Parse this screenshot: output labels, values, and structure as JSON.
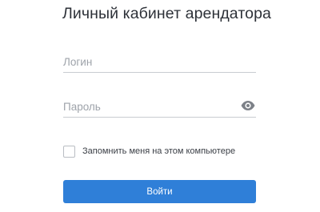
{
  "page": {
    "title": "Личный кабинет арендатора"
  },
  "form": {
    "login": {
      "placeholder": "Логин",
      "value": ""
    },
    "password": {
      "placeholder": "Пароль",
      "value": "",
      "toggle_icon": "eye-icon"
    },
    "remember": {
      "label": "Запомнить меня на этом компьютере",
      "checked": false
    },
    "submit_label": "Войти"
  },
  "colors": {
    "accent": "#2f7fd8",
    "text": "#2d3138",
    "placeholder": "#9ea3aa",
    "divider": "#c9ccd1",
    "icon": "#7d8188"
  }
}
